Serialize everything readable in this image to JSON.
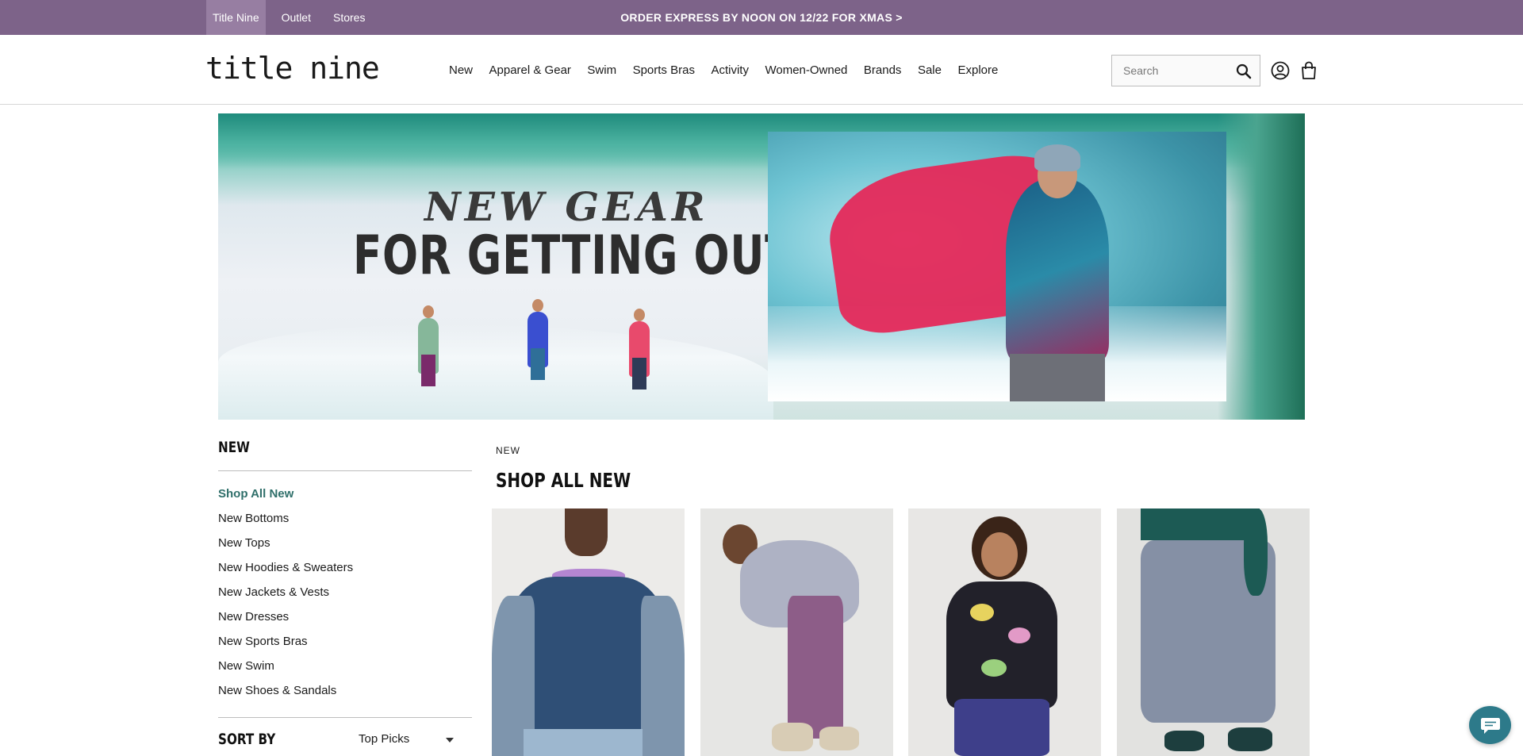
{
  "topbar": {
    "links": [
      {
        "label": "Title Nine",
        "active": true
      },
      {
        "label": "Outlet",
        "active": false
      },
      {
        "label": "Stores",
        "active": false
      }
    ],
    "promo": "ORDER EXPRESS BY NOON ON 12/22 FOR XMAS >",
    "background_color": "#7d6389"
  },
  "header": {
    "logo": "title nine",
    "nav": [
      "New",
      "Apparel & Gear",
      "Swim",
      "Sports Bras",
      "Activity",
      "Women-Owned",
      "Brands",
      "Sale",
      "Explore"
    ],
    "search": {
      "placeholder": "Search",
      "value": ""
    },
    "icons": [
      "search-icon",
      "account-icon",
      "cart-icon"
    ]
  },
  "hero": {
    "headline_top": "NEW GEAR",
    "headline_bottom": "FOR GETTING OUT"
  },
  "sidebar": {
    "title": "NEW",
    "items": [
      {
        "label": "Shop All New",
        "active": true
      },
      {
        "label": "New Bottoms",
        "active": false
      },
      {
        "label": "New Tops",
        "active": false
      },
      {
        "label": "New Hoodies & Sweaters",
        "active": false
      },
      {
        "label": "New Jackets & Vests",
        "active": false
      },
      {
        "label": "New Dresses",
        "active": false
      },
      {
        "label": "New Sports Bras",
        "active": false
      },
      {
        "label": "New Swim",
        "active": false
      },
      {
        "label": "New Shoes & Sandals",
        "active": false
      }
    ],
    "sort_label": "SORT BY",
    "sort_value": "Top Picks",
    "active_color": "#2f6f6a"
  },
  "main": {
    "breadcrumb": "NEW",
    "title": "SHOP ALL NEW"
  },
  "chat": {
    "icon": "chat-icon",
    "color": "#2d7a8a"
  }
}
